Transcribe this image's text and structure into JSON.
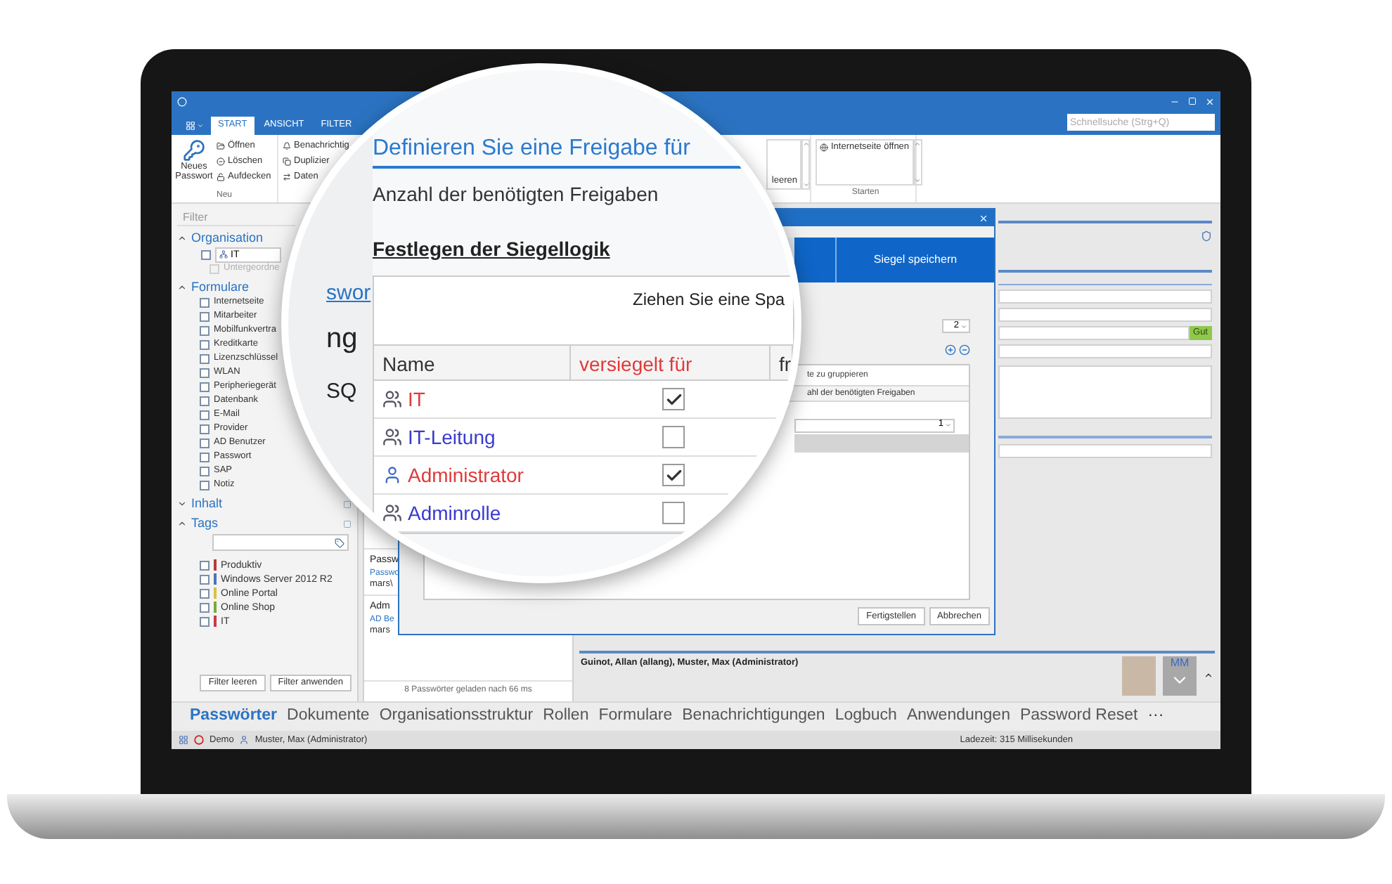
{
  "ribbon": {
    "tabs": [
      {
        "label": "START",
        "selected": true
      },
      {
        "label": "ANSICHT",
        "selected": false
      },
      {
        "label": "FILTER",
        "selected": false
      }
    ],
    "search": {
      "placeholder": "Schnellsuche (Strg+Q)"
    },
    "new_group": {
      "large_button": "Neues Passwort",
      "buttons": [
        "Öffnen",
        "Löschen",
        "Aufdecken"
      ],
      "label": "Neu"
    },
    "second_group": {
      "buttons": [
        "Benachrichtig",
        "Duplizier",
        "Daten"
      ]
    },
    "gallery": {
      "item": "leeren"
    },
    "start_group": {
      "item": "Internetseite öffnen",
      "label": "Starten"
    }
  },
  "sidebar": {
    "filter_placeholder": "Filter",
    "sections": [
      {
        "kind": "organisation",
        "title": "Organisation",
        "expanded": true,
        "checked": false,
        "org": "IT",
        "sub_label": "Untergeordne",
        "sub_disabled": true
      },
      {
        "kind": "checklist",
        "title": "Formulare",
        "expanded": true,
        "items": [
          {
            "label": "Internetseite",
            "checked": false
          },
          {
            "label": "Mitarbeiter",
            "checked": false
          },
          {
            "label": "Mobilfunkvertra",
            "checked": false
          },
          {
            "label": "Kreditkarte",
            "checked": false
          },
          {
            "label": "Lizenzschlüssel",
            "checked": false
          },
          {
            "label": "WLAN",
            "checked": false
          },
          {
            "label": "Peripheriegerät",
            "checked": false
          },
          {
            "label": "Datenbank",
            "checked": false
          },
          {
            "label": "E-Mail",
            "checked": false
          },
          {
            "label": "Provider",
            "checked": false
          },
          {
            "label": "AD Benutzer",
            "checked": false
          },
          {
            "label": "Passwort",
            "checked": false
          },
          {
            "label": "SAP",
            "checked": false
          },
          {
            "label": "Notiz",
            "checked": false
          }
        ]
      },
      {
        "kind": "empty",
        "title": "Inhalt",
        "expanded": false
      },
      {
        "kind": "tags",
        "title": "Tags",
        "expanded": true,
        "items": [
          {
            "label": "Produktiv",
            "color": "#b83a3a",
            "checked": false
          },
          {
            "label": "Windows Server 2012 R2",
            "color": "#4a74b8",
            "checked": false
          },
          {
            "label": "Online Portal",
            "color": "#d8c23a",
            "checked": false
          },
          {
            "label": "Online Shop",
            "color": "#7aa83a",
            "checked": false
          },
          {
            "label": "IT",
            "color": "#c83a4a",
            "checked": false
          }
        ]
      }
    ],
    "buttons": [
      "Filter leeren",
      "Filter anwenden"
    ]
  },
  "list": {
    "items": [
      {
        "title": "Passw",
        "link": "Passwo",
        "user": "mars\\"
      },
      {
        "title": "Adm",
        "link": "AD Be",
        "user": "mars"
      }
    ],
    "status": "8 Passwörter geladen nach 66 ms"
  },
  "dialog": {
    "tab": "Siegel speichern",
    "required_count": "2",
    "group_hint": "te zu gruppieren",
    "column": "ahl der benötigten Freigaben",
    "rows": [
      {
        "value": "1",
        "selected": false
      },
      {
        "selected": true
      }
    ],
    "buttons": [
      "Fertigstellen",
      "Abbrechen"
    ]
  },
  "details": {
    "strength": "Gut",
    "users": "Guinot, Allan (allang), Muster, Max (Administrator)",
    "initials": "MM"
  },
  "magnifier": {
    "title": "Definieren Sie eine Freigabe für",
    "subtitle": "Anzahl der benötigten Freigaben",
    "section": "Festlegen der Siegellogik",
    "group_hint": "Ziehen Sie eine Spa",
    "fragments": [
      "swor",
      "ng",
      "SQ"
    ],
    "columns": [
      "Name",
      "versiegelt für",
      "fr"
    ],
    "rows": [
      {
        "name": "IT",
        "kind": "role",
        "checked": true
      },
      {
        "name": "IT-Leitung",
        "kind": "role",
        "checked": false
      },
      {
        "name": "Administrator",
        "kind": "user",
        "checked": true
      },
      {
        "name": "Adminrolle",
        "kind": "role",
        "checked": false
      }
    ]
  },
  "bottom_nav": {
    "items": [
      {
        "label": "Passwörter",
        "selected": true
      },
      {
        "label": "Dokumente",
        "selected": false
      },
      {
        "label": "Organisationsstruktur",
        "selected": false
      },
      {
        "label": "Rollen",
        "selected": false
      },
      {
        "label": "Formulare",
        "selected": false
      },
      {
        "label": "Benachrichtigungen",
        "selected": false
      },
      {
        "label": "Logbuch",
        "selected": false
      },
      {
        "label": "Anwendungen",
        "selected": false
      },
      {
        "label": "Password Reset",
        "selected": false
      }
    ],
    "more": "···"
  },
  "status_bar": {
    "mode": "Demo",
    "user": "Muster, Max (Administrator)",
    "load_time": "Ladezeit: 315 Millisekunden"
  }
}
